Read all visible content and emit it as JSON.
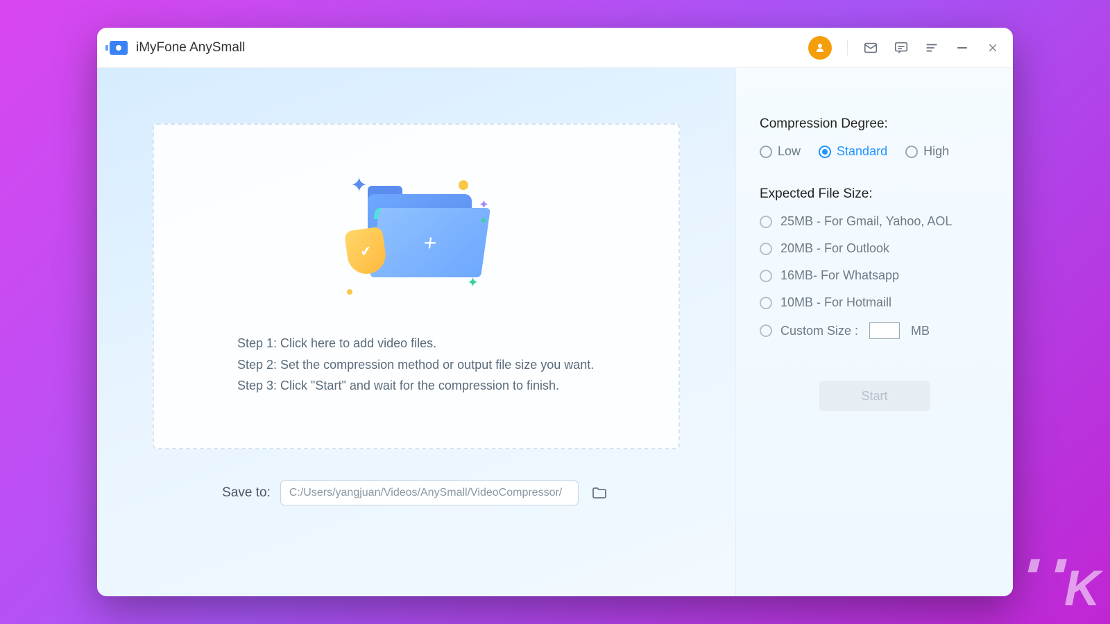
{
  "app": {
    "title": "iMyFone AnySmall"
  },
  "drop": {
    "step1": "Step 1: Click here to add video files.",
    "step2": "Step 2: Set the compression method or output file size you want.",
    "step3": "Step 3: Click \"Start\" and wait for the compression to finish."
  },
  "save": {
    "label": "Save to:",
    "path": "C:/Users/yangjuan/Videos/AnySmall/VideoCompressor/"
  },
  "compression": {
    "title": "Compression Degree:",
    "low": "Low",
    "standard": "Standard",
    "high": "High",
    "selected": "standard"
  },
  "expected": {
    "title": "Expected File Size:",
    "opt25": "25MB - For Gmail, Yahoo, AOL",
    "opt20": "20MB - For Outlook",
    "opt16": "16MB- For Whatsapp",
    "opt10": "10MB - For Hotmaill",
    "custom_prefix": "Custom Size :",
    "custom_unit": "MB"
  },
  "start_label": "Start",
  "watermark": "K"
}
